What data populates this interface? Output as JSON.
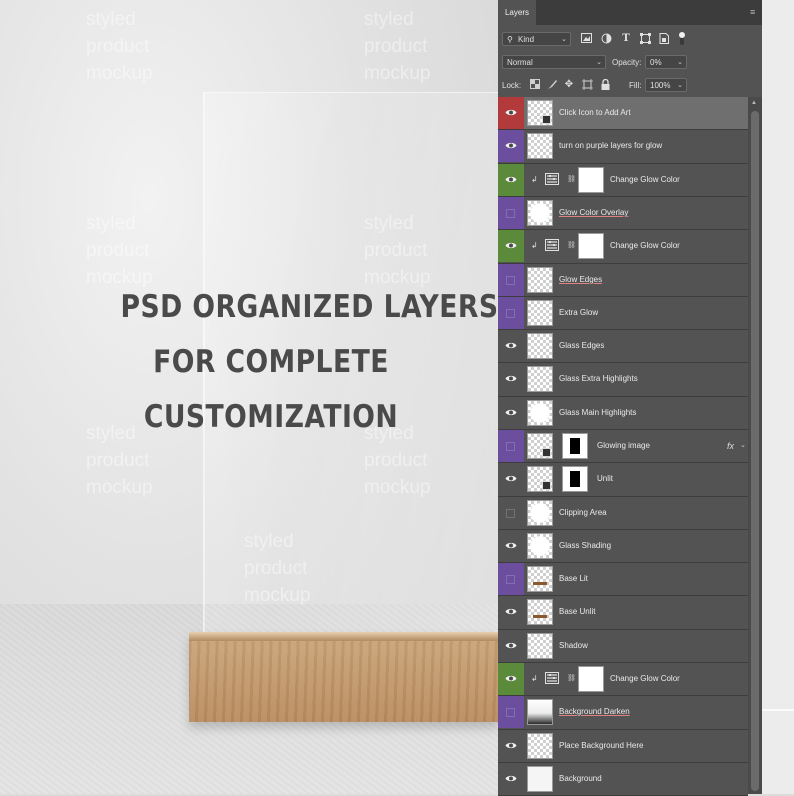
{
  "mockup": {
    "headline": [
      "PSD ORGANIZED LAYERS",
      "FOR COMPLETE",
      "CUSTOMIZATION"
    ],
    "watermark_lines": [
      "styled",
      "product",
      "mockup"
    ]
  },
  "panel": {
    "tab_label": "Layers",
    "menu_icon": "panel-menu-icon",
    "filter": {
      "label": "Kind",
      "icon": "search-icon"
    },
    "filter_icons": [
      "pixel-filter-icon",
      "adjustment-filter-icon",
      "type-filter-icon",
      "shape-filter-icon",
      "smart-object-filter-icon",
      "filter-toggle-icon"
    ],
    "blend_mode": "Normal",
    "opacity_label": "Opacity:",
    "opacity_value": "0%",
    "lock_label": "Lock:",
    "lock_icons": [
      "lock-transparent-icon",
      "lock-pixels-icon",
      "lock-position-icon",
      "lock-artboard-icon",
      "lock-all-icon"
    ],
    "fill_label": "Fill:",
    "fill_value": "100%"
  },
  "colors": {
    "red": "#b23a3a",
    "violet": "#6b4f9e",
    "green": "#5a8a3a",
    "none": "#535353"
  },
  "layers": [
    {
      "name": "Click Icon to Add Art",
      "color": "red",
      "visible": true,
      "thumb": "smart",
      "selected": true
    },
    {
      "name": "turn on purple layers for glow",
      "color": "violet",
      "visible": true,
      "thumb": "checker"
    },
    {
      "name": "Change Glow Color",
      "color": "green",
      "visible": true,
      "thumb": "adjustment",
      "clipped": true
    },
    {
      "name": "Glow Color Overlay",
      "color": "violet",
      "visible": false,
      "thumb": "checker-white",
      "underlined": true
    },
    {
      "name": "Change Glow Color",
      "color": "green",
      "visible": true,
      "thumb": "adjustment",
      "clipped": true
    },
    {
      "name": "Glow Edges",
      "color": "violet",
      "visible": false,
      "thumb": "checker",
      "underlined": true
    },
    {
      "name": "Extra Glow",
      "color": "violet",
      "visible": false,
      "thumb": "checker"
    },
    {
      "name": "Glass Edges",
      "color": "none",
      "visible": true,
      "thumb": "checker"
    },
    {
      "name": "Glass Extra Highlights",
      "color": "none",
      "visible": true,
      "thumb": "checker"
    },
    {
      "name": "Glass Main Highlights",
      "color": "none",
      "visible": true,
      "thumb": "checker-white"
    },
    {
      "name": "Glowing image",
      "color": "violet",
      "visible": false,
      "thumb": "smart-mask",
      "fx": "fx"
    },
    {
      "name": "Unlit",
      "color": "none",
      "visible": true,
      "thumb": "smart-mask"
    },
    {
      "name": "Clipping Area",
      "color": "none",
      "visible": false,
      "thumb": "checker-white"
    },
    {
      "name": "Glass Shading",
      "color": "none",
      "visible": true,
      "thumb": "checker-white"
    },
    {
      "name": "Base Lit",
      "color": "violet",
      "visible": false,
      "thumb": "base"
    },
    {
      "name": "Base Unlit",
      "color": "none",
      "visible": true,
      "thumb": "base"
    },
    {
      "name": "Shadow",
      "color": "none",
      "visible": true,
      "thumb": "checker"
    },
    {
      "name": "Change Glow Color",
      "color": "green",
      "visible": true,
      "thumb": "adjustment",
      "clipped": true
    },
    {
      "name": "Background Darken",
      "color": "violet",
      "visible": false,
      "thumb": "gradient",
      "underlined": true
    },
    {
      "name": "Place Background Here",
      "color": "none",
      "visible": true,
      "thumb": "checker"
    },
    {
      "name": "Background",
      "color": "none",
      "visible": true,
      "thumb": "plain"
    }
  ]
}
